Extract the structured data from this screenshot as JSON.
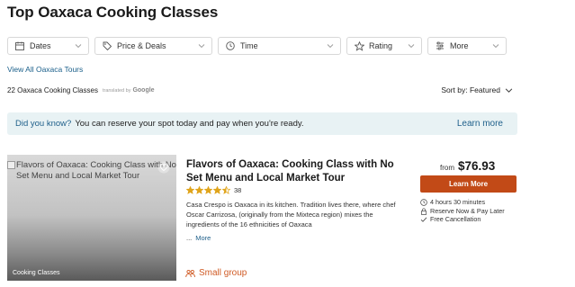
{
  "page": {
    "title": "Top Oaxaca Cooking Classes"
  },
  "filters": [
    {
      "label": "Dates",
      "icon": "calendar-icon"
    },
    {
      "label": "Price & Deals",
      "icon": "tag-icon"
    },
    {
      "label": "Time",
      "icon": "clock-icon"
    },
    {
      "label": "Rating",
      "icon": "star-outline-icon"
    },
    {
      "label": "More",
      "icon": "sliders-icon"
    }
  ],
  "view_all": "View All Oaxaca Tours",
  "results": {
    "count_text": "22 Oaxaca Cooking Classes",
    "translated_text": "translated by",
    "translated_brand": "Google",
    "sort_label": "Sort by: Featured"
  },
  "notice": {
    "question": "Did you know?",
    "text": "You can reserve your spot today and pay when you're ready.",
    "link": "Learn more",
    "bg_color": "#e8f2f4"
  },
  "listing": {
    "image_alt": "Flavors of Oaxaca: Cooking Class with No Set Menu and Local Market Tour",
    "category": "Cooking Classes",
    "title": "Flavors of Oaxaca: Cooking Class with No Set Menu and Local Market Tour",
    "rating": 4.5,
    "review_count": "38",
    "description": "Casa Crespo is Oaxaca in its kitchen. Tradition lives there, where chef Oscar Carrizosa, (originally from the Mixteca region) mixes the ingredients of the 16 ethnicities of Oaxaca",
    "more_prefix": "...",
    "more_link": "More",
    "tag": "Small group",
    "price_prefix": "from",
    "price": "$76.93",
    "cta": "Learn More",
    "cta_color": "#c24a17",
    "features": [
      {
        "icon": "clock-icon",
        "text": "4 hours 30 minutes"
      },
      {
        "icon": "lock-icon",
        "text": "Reserve Now & Pay Later"
      },
      {
        "icon": "check-icon",
        "text": "Free Cancellation"
      }
    ]
  },
  "colors": {
    "link": "#1e5f8a",
    "star": "#e0a41b",
    "accent": "#d05b25"
  }
}
